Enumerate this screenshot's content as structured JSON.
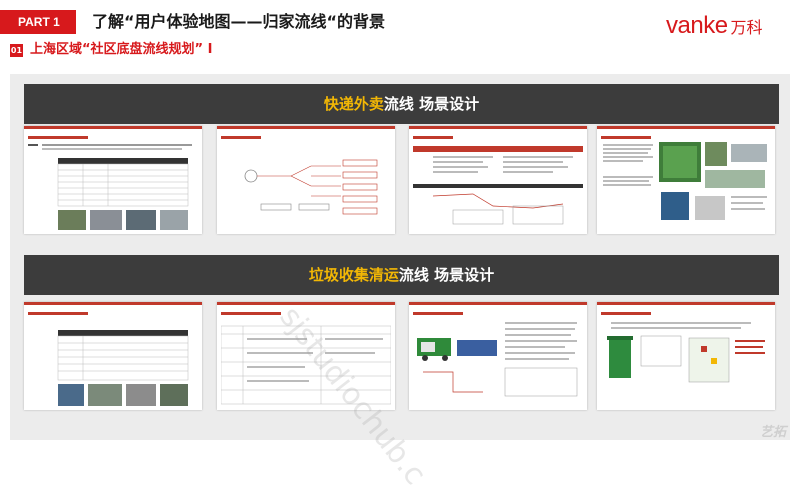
{
  "header": {
    "part_label": "PART 1",
    "title": "了解“用户体验地图——归家流线“的背景",
    "logo_latin": "vanke",
    "logo_cn": "万科"
  },
  "section": {
    "number": "01",
    "title": "上海区域“社区底盘流线规划” I"
  },
  "banners": [
    {
      "highlight": "快递外卖",
      "rest": "流线 场景设计"
    },
    {
      "highlight": "垃圾收集清运",
      "rest": "流线 场景设计"
    }
  ],
  "watermark": "sjstudiochub.c",
  "corner_mark": "艺拓",
  "colors": {
    "brand_red": "#d7191c",
    "banner_bg": "#3c3c3c",
    "highlight": "#f2b705",
    "panel_bg": "#ececec"
  }
}
